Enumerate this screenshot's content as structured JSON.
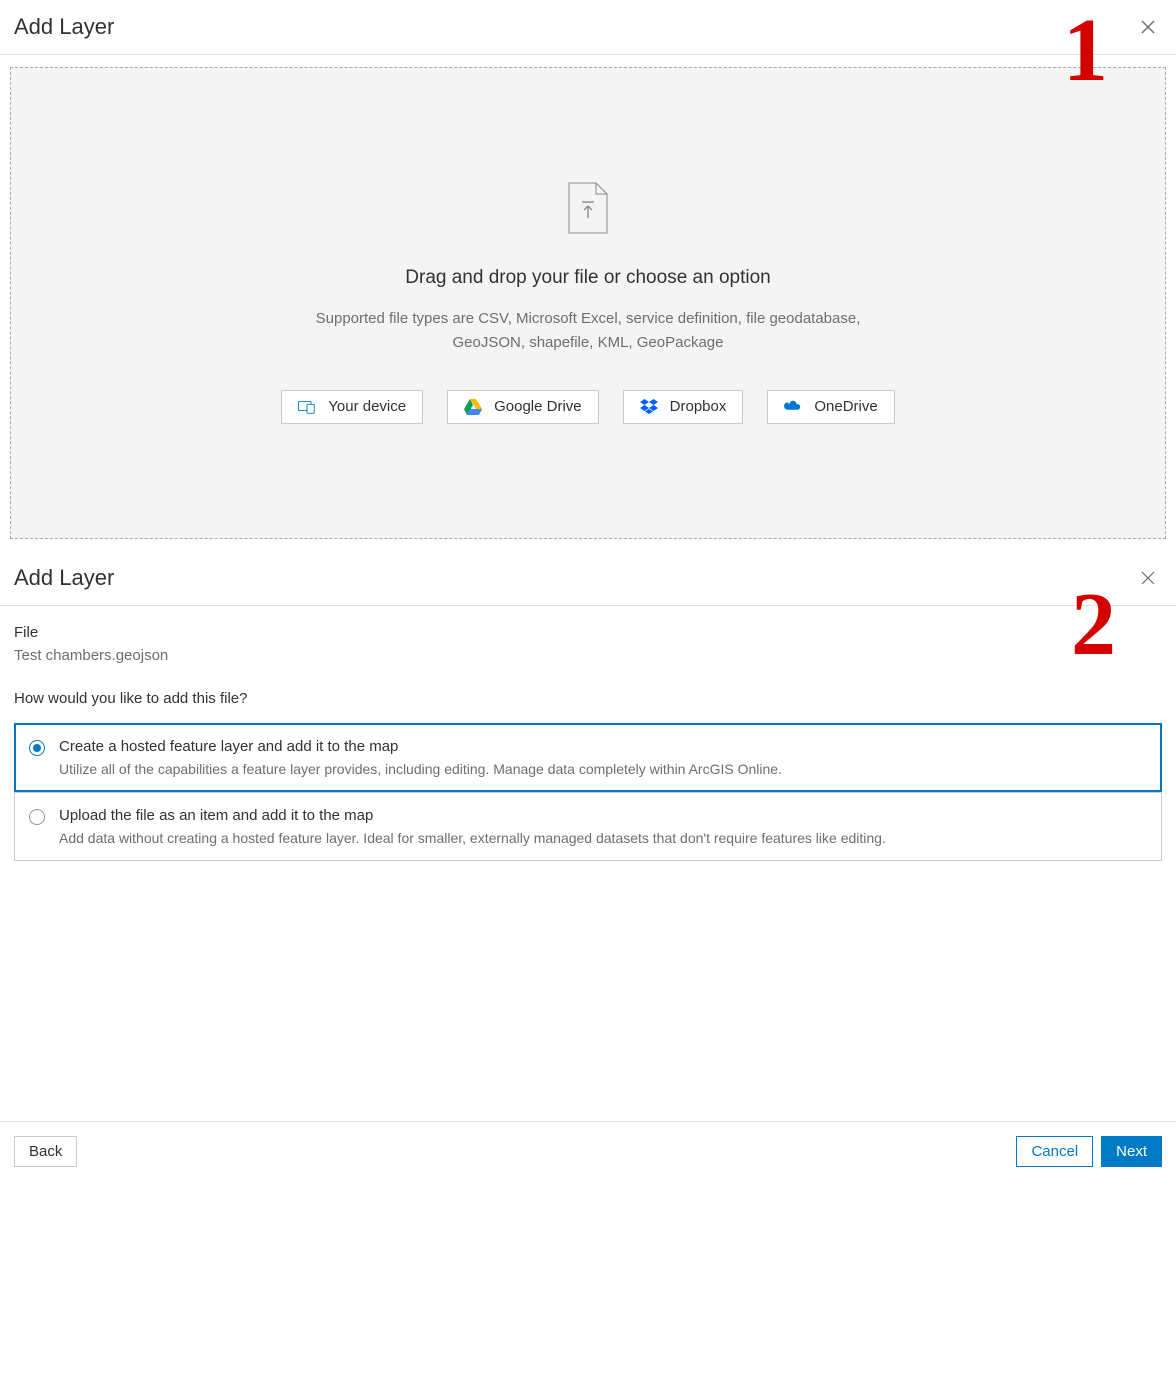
{
  "markers": {
    "one": "1",
    "two": "2"
  },
  "panel1": {
    "title": "Add Layer",
    "dropTitle": "Drag and drop your file or choose an option",
    "dropInfo": "Supported file types are CSV, Microsoft Excel, service definition, file geodatabase, GeoJSON, shapefile, KML, GeoPackage",
    "sources": [
      {
        "label": "Your device",
        "icon": "device"
      },
      {
        "label": "Google Drive",
        "icon": "gdrive"
      },
      {
        "label": "Dropbox",
        "icon": "dropbox"
      },
      {
        "label": "OneDrive",
        "icon": "onedrive"
      }
    ]
  },
  "panel2": {
    "title": "Add Layer",
    "fileLabel": "File",
    "fileName": "Test chambers.geojson",
    "question": "How would you like to add this file?",
    "options": [
      {
        "title": "Create a hosted feature layer and add it to the map",
        "desc": "Utilize all of the capabilities a feature layer provides, including editing. Manage data completely within ArcGIS Online.",
        "selected": true
      },
      {
        "title": "Upload the file as an item and add it to the map",
        "desc": "Add data without creating a hosted feature layer. Ideal for smaller, externally managed datasets that don't require features like editing.",
        "selected": false
      }
    ],
    "footer": {
      "back": "Back",
      "cancel": "Cancel",
      "next": "Next"
    }
  }
}
